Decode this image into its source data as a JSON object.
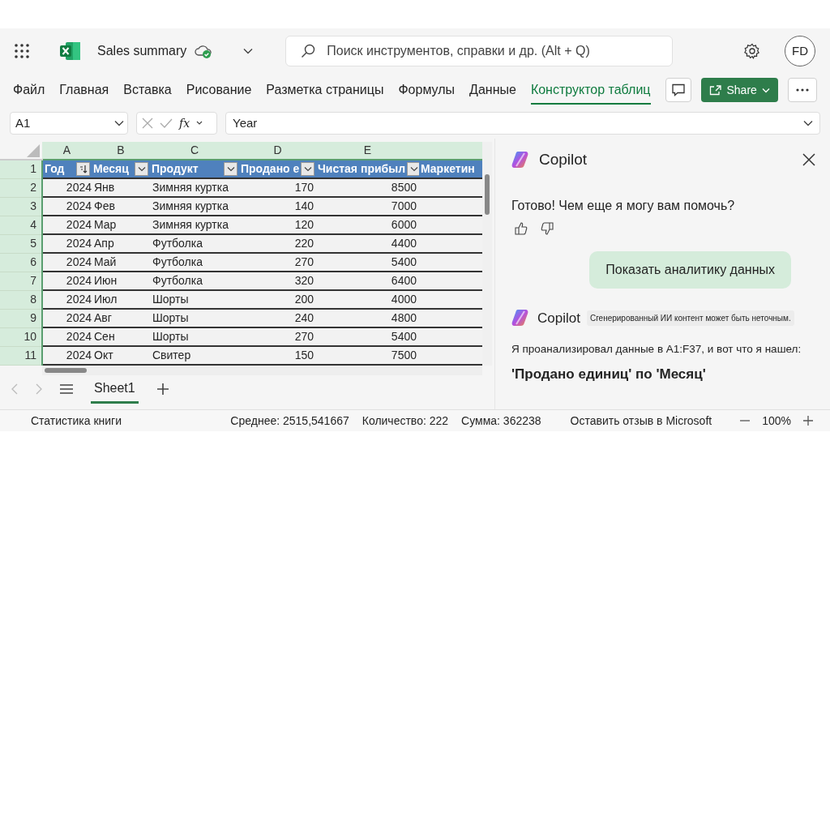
{
  "app": {
    "doc_title": "Sales summary",
    "search": {
      "placeholder": "Поиск инструментов, справки и др. (Alt + Q)"
    },
    "avatar": "FD"
  },
  "ribbon_tabs": [
    {
      "label": "Файл",
      "selected": false
    },
    {
      "label": "Главная",
      "selected": false
    },
    {
      "label": "Вставка",
      "selected": false
    },
    {
      "label": "Рисование",
      "selected": false
    },
    {
      "label": "Разметка страницы",
      "selected": false
    },
    {
      "label": "Формулы",
      "selected": false
    },
    {
      "label": "Данные",
      "selected": false
    },
    {
      "label": "Конструктор таблиц",
      "selected": true
    }
  ],
  "share": "Share",
  "formula_bar": {
    "name_box": "A1",
    "fx": "fx",
    "value": "Year"
  },
  "sheet": {
    "columns": [
      {
        "letter": "A",
        "kind": "number"
      },
      {
        "letter": "B",
        "kind": "text"
      },
      {
        "letter": "C",
        "kind": "text"
      },
      {
        "letter": "D",
        "kind": "number"
      },
      {
        "letter": "E",
        "kind": "number"
      }
    ],
    "header_row": {
      "number": "1",
      "cells": [
        {
          "label": "Год",
          "kind": "sort"
        },
        {
          "label": "Месяц",
          "kind": "dropdown"
        },
        {
          "label": "Продукт",
          "kind": "dropdown"
        },
        {
          "label": "Продано е",
          "kind": "dropdown"
        },
        {
          "label": "Чистая прибыл",
          "kind": "dropdown"
        },
        {
          "label": "Маркетин",
          "kind": "plain"
        }
      ]
    },
    "rows": [
      {
        "number": "2",
        "cells": [
          "2024",
          "Янв",
          "Зимняя куртка",
          "170",
          "8500"
        ]
      },
      {
        "number": "3",
        "cells": [
          "2024",
          "Фев",
          "Зимняя куртка",
          "140",
          "7000"
        ]
      },
      {
        "number": "4",
        "cells": [
          "2024",
          "Мар",
          "Зимняя куртка",
          "120",
          "6000"
        ]
      },
      {
        "number": "5",
        "cells": [
          "2024",
          "Апр",
          "Футболка",
          "220",
          "4400"
        ]
      },
      {
        "number": "6",
        "cells": [
          "2024",
          "Май",
          "Футболка",
          "270",
          "5400"
        ]
      },
      {
        "number": "7",
        "cells": [
          "2024",
          "Июн",
          "Футболка",
          "320",
          "6400"
        ]
      },
      {
        "number": "8",
        "cells": [
          "2024",
          "Июл",
          "Шорты",
          "200",
          "4000"
        ]
      },
      {
        "number": "9",
        "cells": [
          "2024",
          "Авг",
          "Шорты",
          "240",
          "4800"
        ]
      },
      {
        "number": "10",
        "cells": [
          "2024",
          "Сен",
          "Шорты",
          "270",
          "5400"
        ]
      },
      {
        "number": "11",
        "cells": [
          "2024",
          "Окт",
          "Свитер",
          "150",
          "7500"
        ]
      }
    ]
  },
  "sheet_tabs": [
    {
      "label": "Sheet1",
      "selected": true
    }
  ],
  "copilot": {
    "title": "Copilot",
    "reply": "Готово! Чем еще я могу вам помочь?",
    "suggestion": "Показать аналитику данных",
    "second_name": "Copilot",
    "disclaimer": "Сгенерированный ИИ контент может быть неточным.",
    "analysis_text": "Я проанализировал данные в A1:F37, и вот что я нашел:",
    "analysis_heading": "'Продано единиц' по 'Месяц'"
  },
  "status_bar": {
    "workbook_stats": "Статистика книги",
    "average": "Среднее: 2515,541667",
    "count": "Количество: 222",
    "sum": "Сумма: 362238",
    "feedback": "Оставить отзыв в Microsoft",
    "zoom": "100%"
  }
}
